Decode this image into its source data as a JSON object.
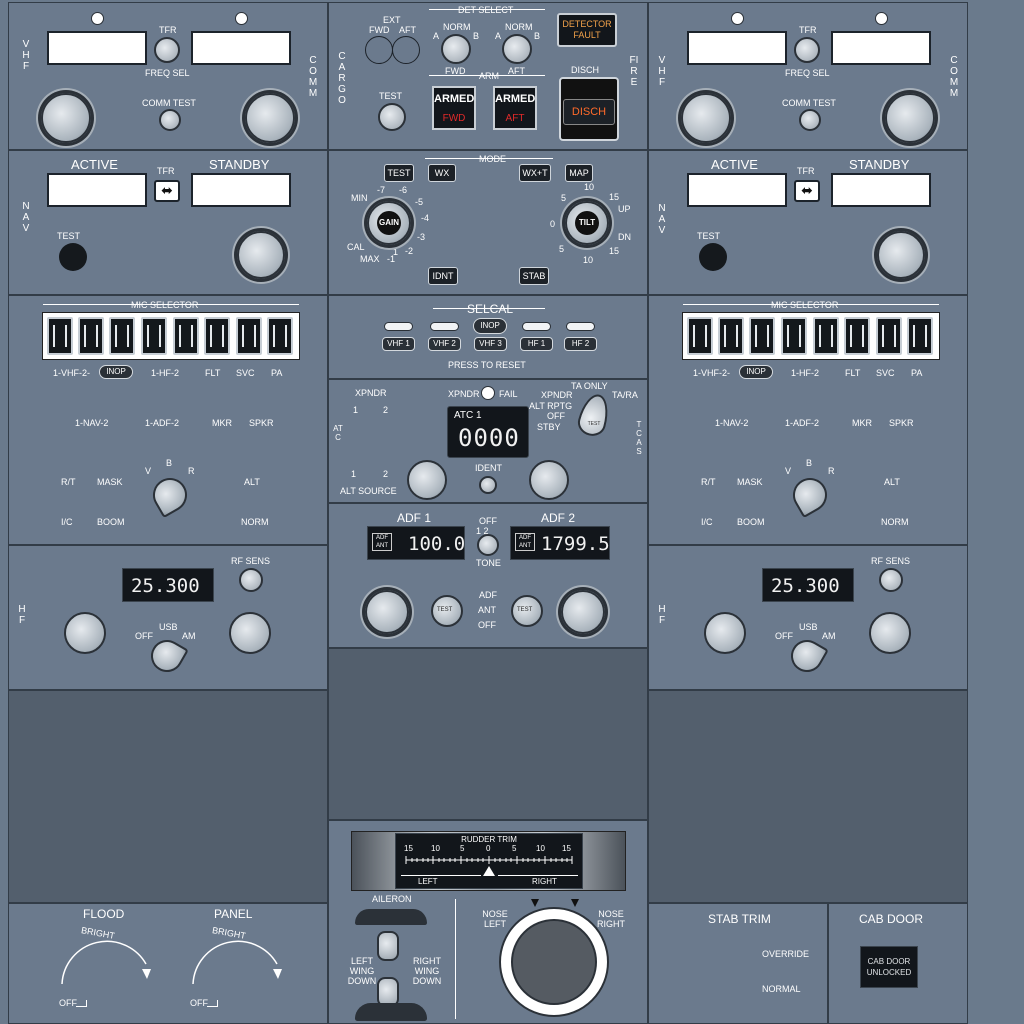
{
  "left": {
    "vhf_label": "VHF",
    "comm_label": "COMM",
    "tfr": "TFR",
    "freq_sel": "FREQ SEL",
    "comm_test": "COMM TEST",
    "nav_label": "NAV",
    "active": "ACTIVE",
    "standby": "STANDBY",
    "nav_tfr": "TFR",
    "test": "TEST",
    "mic_selector": "MIC SELECTOR",
    "mic_row1": [
      "1-VHF-2-",
      "INOP",
      "1-HF-2",
      "FLT",
      "SVC",
      "PA"
    ],
    "mic_row2": [
      "1-NAV-2",
      "1-ADF-2",
      "MKR",
      "SPKR"
    ],
    "rt": "R/T",
    "mask": "MASK",
    "v": "V",
    "b": "B",
    "r": "R",
    "alt": "ALT",
    "ic": "I/C",
    "boom": "BOOM",
    "norm": "NORM",
    "hf_label": "HF",
    "hf_freq": "25.300",
    "rf_sens": "RF SENS",
    "usb": "USB",
    "off": "OFF",
    "am": "AM"
  },
  "right": {
    "vhf_label": "VHF",
    "comm_label": "COMM",
    "tfr": "TFR",
    "freq_sel": "FREQ SEL",
    "comm_test": "COMM TEST",
    "nav_label": "NAV",
    "active": "ACTIVE",
    "standby": "STANDBY",
    "nav_tfr": "TFR",
    "test": "TEST",
    "mic_selector": "MIC SELECTOR",
    "mic_row1": [
      "1-VHF-2-",
      "INOP",
      "1-HF-2",
      "FLT",
      "SVC",
      "PA"
    ],
    "mic_row2": [
      "1-NAV-2",
      "1-ADF-2",
      "MKR",
      "SPKR"
    ],
    "rt": "R/T",
    "mask": "MASK",
    "v": "V",
    "b": "B",
    "r": "R",
    "alt": "ALT",
    "ic": "I/C",
    "boom": "BOOM",
    "norm": "NORM",
    "hf_label": "HF",
    "hf_freq": "25.300",
    "rf_sens": "RF SENS",
    "usb": "USB",
    "off": "OFF",
    "am": "AM"
  },
  "fire": {
    "det_select": "DET SELECT",
    "cargo_label": "CARGO",
    "fire_label": "FIRE",
    "ext": "EXT",
    "fwd": "FWD",
    "aft": "AFT",
    "norm": "NORM",
    "a": "A",
    "b": "B",
    "arm": "ARM",
    "detector_fault": "DETECTOR FAULT",
    "disch": "DISCH",
    "test": "TEST",
    "armed": "ARMED",
    "fwd_red": "FWD",
    "aft_red": "AFT",
    "disch_btn": "DISCH"
  },
  "wx": {
    "mode": "MODE",
    "test": "TEST",
    "wx": "WX",
    "wxt": "WX+T",
    "map": "MAP",
    "gain": "GAIN",
    "tilt": "TILT",
    "min": "MIN",
    "cal": "CAL",
    "max": "MAX",
    "gain_ticks": [
      "-7",
      "-6",
      "-5",
      "-4",
      "-3",
      "-2",
      "-1",
      "1"
    ],
    "tilt_ticks": [
      "5",
      "10",
      "15",
      "UP",
      "0",
      "5",
      "10",
      "15",
      "DN"
    ],
    "idnt": "IDNT",
    "stab": "STAB"
  },
  "selcal": {
    "title": "SELCAL",
    "inop": "INOP",
    "buttons": [
      "VHF 1",
      "VHF 2",
      "VHF 3",
      "HF 1",
      "HF 2"
    ],
    "press_to_reset": "PRESS TO RESET"
  },
  "atc": {
    "xpndr": "XPNDR",
    "xpndr_fail": "XPNDR",
    "fail": "FAIL",
    "sel1": "1",
    "sel2": "2",
    "atc_label": "ATC",
    "tcas_label": "TCAS",
    "display_title": "ATC 1",
    "code": "0000",
    "ta_only": "TA ONLY",
    "ta_ra": "TA/RA",
    "xpndr_mode": "XPNDR",
    "alt_rptg": "ALT RPTG",
    "off": "OFF",
    "stby": "STBY",
    "ident": "IDENT",
    "alt_source": "ALT SOURCE",
    "src1": "1",
    "src2": "2",
    "mode_knob": "TEST"
  },
  "adf": {
    "adf1": "ADF 1",
    "adf2": "ADF 2",
    "off": "OFF",
    "tone_sel": "1 2",
    "tone": "TONE",
    "freq1": "100.0",
    "freq2": "1799.5",
    "adf_ant": "ADF ANT",
    "adf": "ADF",
    "ant": "ANT",
    "mode_off": "OFF",
    "test": "TEST"
  },
  "rudder": {
    "title": "RUDDER TRIM",
    "scale": [
      "15",
      "10",
      "5",
      "0",
      "5",
      "10",
      "15"
    ],
    "left": "LEFT",
    "right": "RIGHT",
    "aileron": "AILERON",
    "left_wing_down": "LEFT WING DOWN",
    "right_wing_down": "RIGHT WING DOWN",
    "nose_left": "NOSE LEFT",
    "nose_right": "NOSE RIGHT"
  },
  "lights": {
    "flood": "FLOOD",
    "panel": "PANEL",
    "bright": "BRIGHT",
    "off": "OFF"
  },
  "stab": {
    "title": "STAB TRIM",
    "override": "OVERRIDE",
    "normal": "NORMAL",
    "cab_door": "CAB DOOR",
    "cab_door_unlocked": "CAB DOOR UNLOCKED"
  }
}
